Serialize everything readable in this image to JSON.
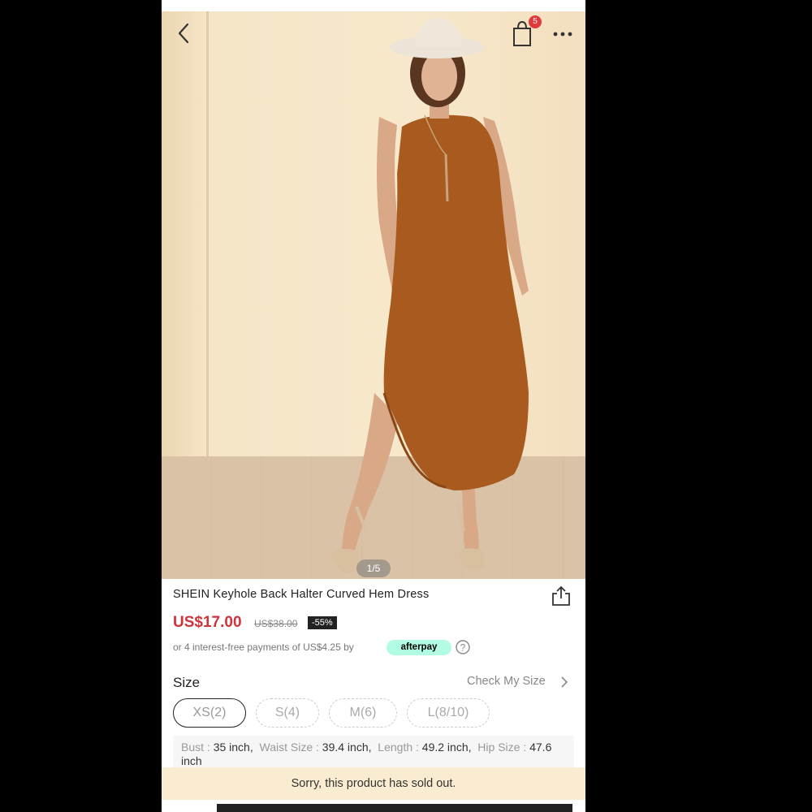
{
  "nav": {
    "back_icon": "chevron-left-icon",
    "cart_icon": "shopping-bag-icon",
    "cart_count": "5",
    "more_icon": "more-horizontal-icon"
  },
  "gallery": {
    "indicator": "1/5",
    "current": 1,
    "total": 5
  },
  "product": {
    "title": "SHEIN Keyhole Back Halter Curved Hem Dress",
    "share_icon": "share-icon",
    "price": "US$17.00",
    "original_price": "US$38.00",
    "discount": "-55%",
    "afterpay_text": "or 4 interest-free payments of US$4.25 by",
    "afterpay_logo": "afterpay",
    "help_icon": "question-circle-icon"
  },
  "size": {
    "label": "Size",
    "check_my_size": "Check My Size",
    "options": [
      "XS(2)",
      "S(4)",
      "M(6)",
      "L(8/10)"
    ],
    "selected": "XS(2)",
    "measurements": {
      "bust_label": "Bust : ",
      "bust_value": "35 inch,",
      "waist_label": "Waist Size : ",
      "waist_value": "39.4 inch,",
      "length_label": "Length : ",
      "length_value": "49.2 inch,",
      "hip_label": "Hip Size : ",
      "hip_value": "47.6 inch"
    }
  },
  "status": {
    "sold_out": "Sorry, this product has sold out."
  },
  "colors": {
    "price_red": "#d0333c",
    "badge_red": "#e4393c",
    "afterpay_mint": "#b2fce4",
    "soldout_bg": "#faecd0",
    "dress": "#a85a1f"
  }
}
